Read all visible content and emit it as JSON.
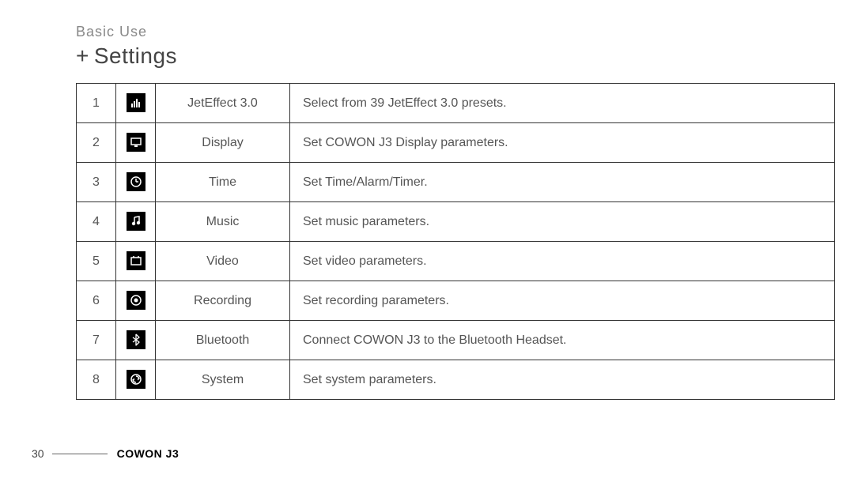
{
  "breadcrumb": "Basic Use",
  "heading_prefix": "+",
  "heading": "Settings",
  "rows": [
    {
      "n": "1",
      "icon": "jeteffect",
      "label": "JetEffect 3.0",
      "desc": "Select from 39 JetEffect 3.0 presets."
    },
    {
      "n": "2",
      "icon": "display",
      "label": "Display",
      "desc": "Set COWON J3 Display parameters."
    },
    {
      "n": "3",
      "icon": "time",
      "label": "Time",
      "desc": "Set Time/Alarm/Timer."
    },
    {
      "n": "4",
      "icon": "music",
      "label": "Music",
      "desc": "Set music parameters."
    },
    {
      "n": "5",
      "icon": "video",
      "label": "Video",
      "desc": "Set video parameters."
    },
    {
      "n": "6",
      "icon": "recording",
      "label": "Recording",
      "desc": "Set recording parameters."
    },
    {
      "n": "7",
      "icon": "bluetooth",
      "label": "Bluetooth",
      "desc": "Connect COWON J3 to the Bluetooth Headset."
    },
    {
      "n": "8",
      "icon": "system",
      "label": "System",
      "desc": "Set system parameters."
    }
  ],
  "page_number": "30",
  "product": "COWON J3"
}
